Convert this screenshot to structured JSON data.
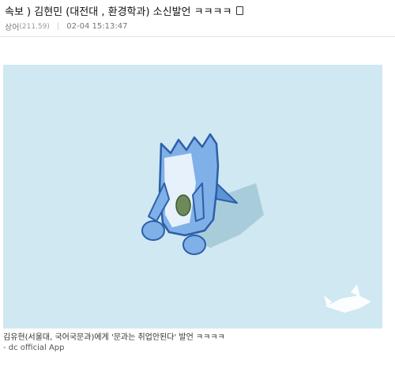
{
  "post": {
    "title": "속보 ) 김현민 (대전대 , 환경학과) 소신발언 ㅋㅋㅋㅋ",
    "title_icon": "image-attachment-icon",
    "author": "상어",
    "author_ip": "(211.59)",
    "separator": "|",
    "datetime": "02-04 15:13:47"
  },
  "image": {
    "background_color": "#cfe8f2",
    "subject": "shark-character-illustration",
    "watermark_icon": "shark-logo-icon"
  },
  "caption": "김유현(서울대, 국어국문과)에게 '문과는 취업안된다' 발언 ㅋㅋㅋㅋ",
  "source": "- dc official App"
}
